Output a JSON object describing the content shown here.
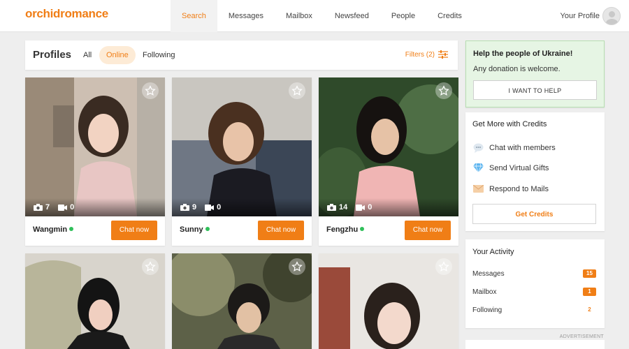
{
  "header": {
    "logo": "orchidromance",
    "nav": [
      {
        "label": "Search",
        "active": true
      },
      {
        "label": "Messages"
      },
      {
        "label": "Mailbox"
      },
      {
        "label": "Newsfeed"
      },
      {
        "label": "People"
      },
      {
        "label": "Credits"
      }
    ],
    "profile_label": "Your Profile"
  },
  "profiles_bar": {
    "title": "Profiles",
    "tabs": [
      {
        "label": "All"
      },
      {
        "label": "Online",
        "active": true
      },
      {
        "label": "Following"
      }
    ],
    "filters_label": "Filters (2)"
  },
  "profiles": [
    {
      "name": "Wangmin",
      "photos": "7",
      "videos": "0",
      "online": true,
      "chat_label": "Chat now"
    },
    {
      "name": "Sunny",
      "photos": "9",
      "videos": "0",
      "online": true,
      "chat_label": "Chat now"
    },
    {
      "name": "Fengzhu",
      "photos": "14",
      "videos": "0",
      "online": true,
      "chat_label": "Chat now"
    }
  ],
  "ukraine": {
    "title": "Help the people of Ukraine!",
    "subtitle": "Any donation is welcome.",
    "button": "I WANT TO HELP"
  },
  "credits_panel": {
    "title": "Get More with Credits",
    "items": [
      {
        "label": "Chat with members",
        "icon": "chat-bubble-icon"
      },
      {
        "label": "Send Virtual Gifts",
        "icon": "diamond-icon"
      },
      {
        "label": "Respond to Mails",
        "icon": "envelope-icon"
      }
    ],
    "button": "Get Credits"
  },
  "activity": {
    "title": "Your Activity",
    "rows": [
      {
        "label": "Messages",
        "count": "15"
      },
      {
        "label": "Mailbox",
        "count": "1"
      },
      {
        "label": "Following",
        "count": "2"
      }
    ]
  },
  "advertisement_label": "ADVERTISEMENT",
  "colors": {
    "accent": "#f07e16",
    "online": "#2fbf5a",
    "ukraine_bg": "#e6f5e4"
  }
}
